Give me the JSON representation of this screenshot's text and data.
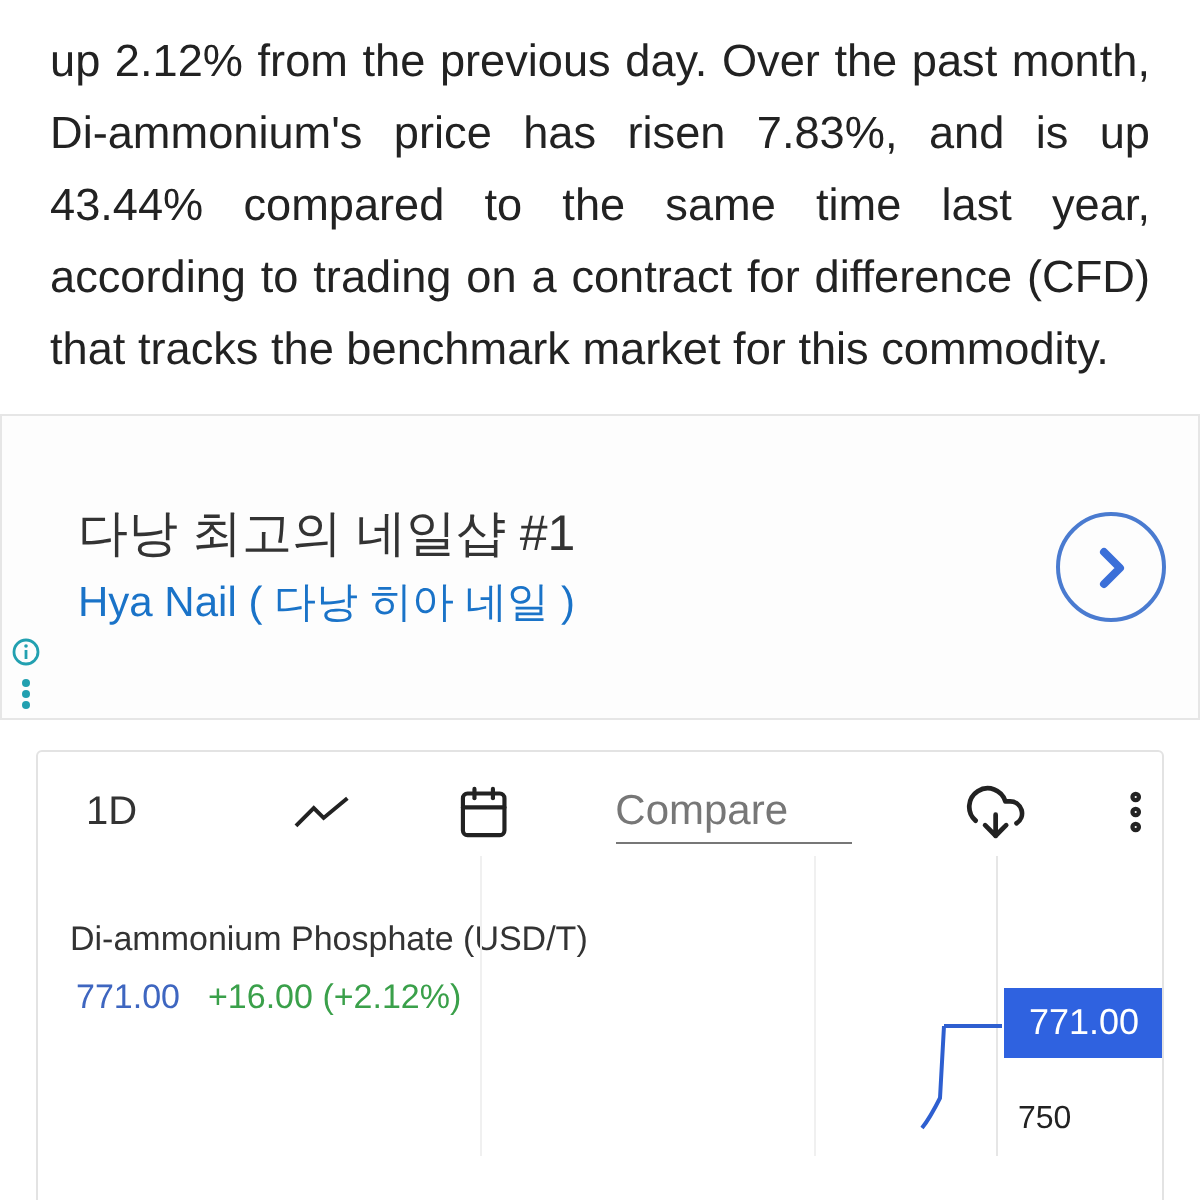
{
  "article": {
    "paragraph": "up 2.12% from the previous day. Over the past month, Di-ammonium's price has risen 7.83%, and is up 43.44% compared to the same time last year, according to trading on a contract for difference (CFD) that tracks the benchmark market for this commodity."
  },
  "ad": {
    "headline": "다낭 최고의 네일샵 #1",
    "advertiser": "Hya Nail ( 다낭 히아 네일 )"
  },
  "chart_widget": {
    "toolbar": {
      "interval": "1D",
      "compare": {
        "placeholder": "Compare"
      }
    },
    "title": "Di-ammonium Phosphate (USD/T)",
    "price": "771.00",
    "change": "+16.00 (+2.12%)",
    "price_tag": "771.00",
    "axis_labels": [
      "750"
    ]
  }
}
